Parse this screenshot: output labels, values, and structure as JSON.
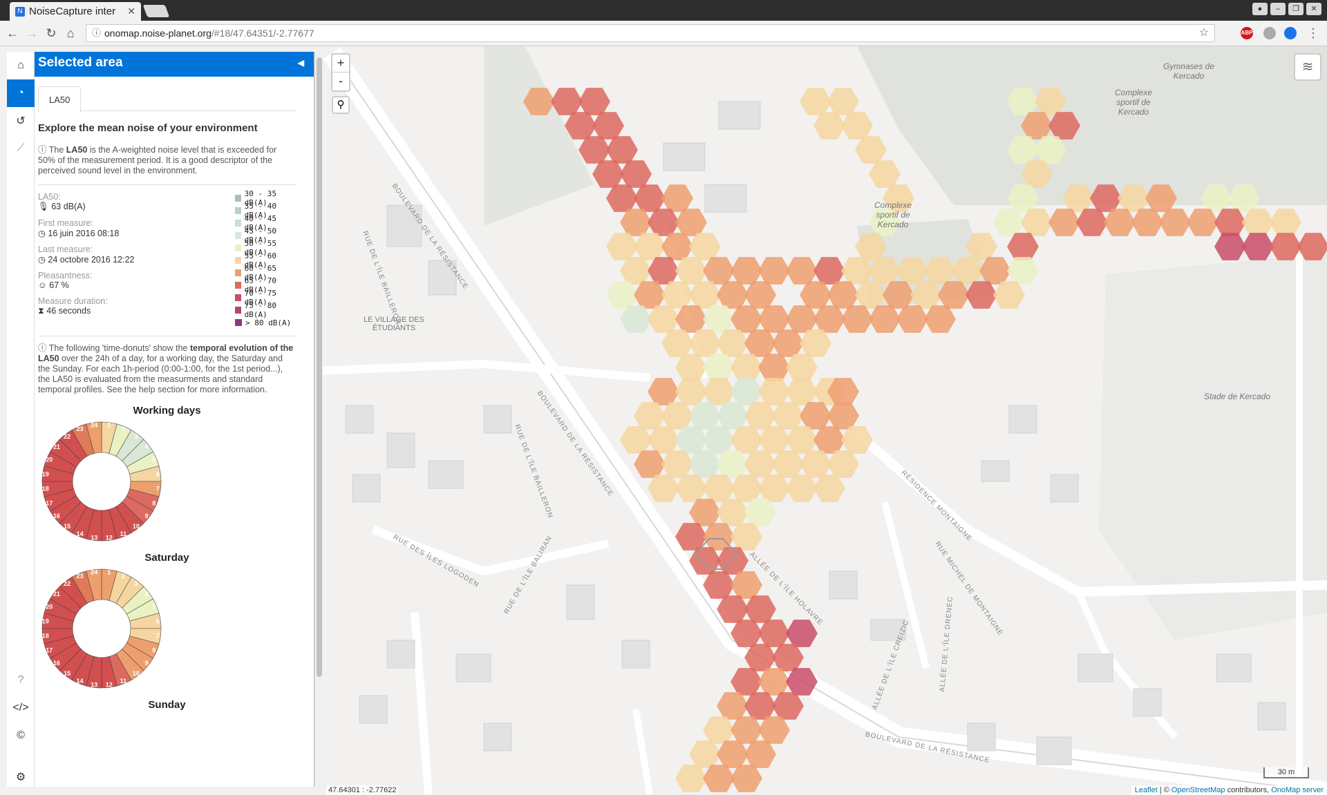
{
  "browser": {
    "tab_title": "NoiseCapture inter",
    "url_host": "onomap.noise-planet.org",
    "url_path": "/#18/47.64351/-2.77677",
    "ext_abp": "ABP"
  },
  "panel": {
    "title": "Selected area",
    "tab": "LA50",
    "heading": "Explore the mean noise of your environment",
    "intro_pre": " The ",
    "intro_bold": "LA50",
    "intro_post": " is the A-weighted noise level that is exceeded for 50% of the measurement period. It is a good descriptor of the perceived sound level in the environment.",
    "stats": {
      "la50_label": "LA50:",
      "la50_value": "63 dB(A)",
      "first_label": "First measure:",
      "first_value": "16 juin 2016 08:18",
      "last_label": "Last measure:",
      "last_value": "24 octobre 2016 12:22",
      "pleasant_label": "Pleasantness:",
      "pleasant_value": "67 %",
      "duration_label": "Measure duration:",
      "duration_value": "46 seconds"
    },
    "legend": [
      {
        "label": "30 - 35 dB(A)",
        "color": "#a9bcc4"
      },
      {
        "label": "35 - 40 dB(A)",
        "color": "#b8cdd4"
      },
      {
        "label": "40 - 45  dB(A)",
        "color": "#cadedb"
      },
      {
        "label": "45 - 50 dB(A)",
        "color": "#d9e8d4"
      },
      {
        "label": "50 - 55 dB(A)",
        "color": "#eaf2c4"
      },
      {
        "label": "55 - 60 dB(A)",
        "color": "#f6d6a0"
      },
      {
        "label": "60 - 65 dB(A)",
        "color": "#ee9f6e"
      },
      {
        "label": "65 - 70 dB(A)",
        "color": "#dd6a60"
      },
      {
        "label": "70 - 75 dB(A)",
        "color": "#c94d68"
      },
      {
        "label": "75 - 80 dB(A)",
        "color": "#b04679"
      },
      {
        "label": "> 80 dB(A)",
        "color": "#8a3a78"
      }
    ],
    "temporal_pre": " The following 'time-donuts' show the ",
    "temporal_bold1": "temporal evolution of the LA50",
    "temporal_post": " over the 24h of a day, for a working day, the Saturday and the Sunday. For each 1h-period (0:00-1:00, for the 1st period...), the LA50 is evaluated from the measurments and standard temporal profiles. See the help section for more information.",
    "donuts": [
      {
        "title": "Working days",
        "colors": [
          "#f6d6a0",
          "#eaf2c4",
          "#d9e8d4",
          "#d9e8d4",
          "#eaf2c4",
          "#f6d6a0",
          "#ee9f6e",
          "#dd6a60",
          "#dd6a60",
          "#d24f4f",
          "#d24f4f",
          "#d24f4f",
          "#d24f4f",
          "#d24f4f",
          "#d24f4f",
          "#d24f4f",
          "#d24f4f",
          "#d24f4f",
          "#d24f4f",
          "#d24f4f",
          "#d24f4f",
          "#d24f4f",
          "#e07b5a",
          "#ee9f6e"
        ]
      },
      {
        "title": "Saturday",
        "colors": [
          "#ee9f6e",
          "#f6d6a0",
          "#f6d6a0",
          "#eaf2c4",
          "#eaf2c4",
          "#f6d6a0",
          "#f6d6a0",
          "#ee9f6e",
          "#ee9f6e",
          "#ee9f6e",
          "#dd6a60",
          "#d24f4f",
          "#d24f4f",
          "#d24f4f",
          "#d24f4f",
          "#d24f4f",
          "#d24f4f",
          "#d24f4f",
          "#d24f4f",
          "#d24f4f",
          "#d24f4f",
          "#d24f4f",
          "#e07b5a",
          "#ee9f6e"
        ]
      },
      {
        "title": "Sunday",
        "colors": []
      }
    ]
  },
  "map": {
    "coords": "47.64301 : -2.77622",
    "scale": "30 m",
    "attrib_leaflet": "Leaflet",
    "attrib_mid": " | © ",
    "attrib_osm": "OpenStreetMap",
    "attrib_contrib": " contributors, ",
    "attrib_onomap": "OnoMap server",
    "zoom_in": "+",
    "zoom_out": "-",
    "labels": {
      "gymnases": "Gymnases de Kercado",
      "complexe_right": "Complexe sportif de Kercado",
      "complexe_left": "Complexe sportif de Kercado",
      "village": "LE VILLAGE DES ÉTUDIANTS",
      "stade": "Stade de Kercado",
      "bd_resistance_1": "BOULEVARD DE LA RÉSISTANCE",
      "bd_resistance_2": "BOULEVARD DE LA RÉSISTANCE",
      "bd_resistance_3": "BOULEVARD DE LA RÉSISTANCE",
      "rue_baileron_1": "RUE DE L'ÎLE BAILLERON",
      "rue_baileron_2": "RUE DE L'ÎLE BAILLERON",
      "rue_logoden": "RUE DES ÎLES LOGODEN",
      "rue_baliran": "RUE DE L'ÎLE BALIRAN",
      "rue_montaigne": "RUE MICHEL DE MONTAIGNE",
      "residence": "RÉSIDENCE MONTAIGNE",
      "allee_holavre": "ALLÉE DE L'ÎLE HOLAVRE",
      "allee_creizic": "ALLÉE DE L'ÎLE CREIZIC",
      "allee_drenec": "ALLÉE DE L'ÎLE DRENEC"
    }
  },
  "hexgrid": [
    [
      780,
      80,
      "#ee9f6e"
    ],
    [
      820,
      80,
      "#dd6a60"
    ],
    [
      860,
      80,
      "#dd6a60"
    ],
    [
      1180,
      80,
      "#f6d6a0"
    ],
    [
      1220,
      80,
      "#f6d6a0"
    ],
    [
      1480,
      80,
      "#eaf2c4"
    ],
    [
      1520,
      80,
      "#f6d6a0"
    ],
    [
      840,
      115,
      "#dd6a60"
    ],
    [
      880,
      115,
      "#dd6a60"
    ],
    [
      1200,
      115,
      "#f6d6a0"
    ],
    [
      1240,
      115,
      "#f6d6a0"
    ],
    [
      1500,
      115,
      "#ee9f6e"
    ],
    [
      1540,
      115,
      "#dd6a60"
    ],
    [
      860,
      150,
      "#dd6a60"
    ],
    [
      900,
      150,
      "#dd6a60"
    ],
    [
      1260,
      150,
      "#f6d6a0"
    ],
    [
      1480,
      150,
      "#eaf2c4"
    ],
    [
      1520,
      150,
      "#eaf2c4"
    ],
    [
      880,
      185,
      "#dd6a60"
    ],
    [
      920,
      185,
      "#dd6a60"
    ],
    [
      1280,
      185,
      "#f6d6a0"
    ],
    [
      1500,
      185,
      "#f6d6a0"
    ],
    [
      900,
      220,
      "#dd6a60"
    ],
    [
      940,
      220,
      "#dd6a60"
    ],
    [
      980,
      220,
      "#ee9f6e"
    ],
    [
      1300,
      220,
      "#f6d6a0"
    ],
    [
      1480,
      220,
      "#eaf2c4"
    ],
    [
      1560,
      220,
      "#f6d6a0"
    ],
    [
      1600,
      220,
      "#dd6a60"
    ],
    [
      1640,
      220,
      "#f6d6a0"
    ],
    [
      1680,
      220,
      "#ee9f6e"
    ],
    [
      1760,
      220,
      "#eaf2c4"
    ],
    [
      1800,
      220,
      "#eaf2c4"
    ],
    [
      920,
      255,
      "#ee9f6e"
    ],
    [
      960,
      255,
      "#dd6a60"
    ],
    [
      1000,
      255,
      "#ee9f6e"
    ],
    [
      1280,
      255,
      "#eaf2c4"
    ],
    [
      1460,
      255,
      "#eaf2c4"
    ],
    [
      1500,
      255,
      "#f6d6a0"
    ],
    [
      1540,
      255,
      "#ee9f6e"
    ],
    [
      1580,
      255,
      "#dd6a60"
    ],
    [
      1620,
      255,
      "#ee9f6e"
    ],
    [
      1660,
      255,
      "#ee9f6e"
    ],
    [
      1700,
      255,
      "#ee9f6e"
    ],
    [
      1740,
      255,
      "#ee9f6e"
    ],
    [
      1780,
      255,
      "#dd6a60"
    ],
    [
      1820,
      255,
      "#f6d6a0"
    ],
    [
      1860,
      255,
      "#f6d6a0"
    ],
    [
      900,
      290,
      "#f6d6a0"
    ],
    [
      940,
      290,
      "#f6d6a0"
    ],
    [
      980,
      290,
      "#ee9f6e"
    ],
    [
      1020,
      290,
      "#f6d6a0"
    ],
    [
      1260,
      290,
      "#f6d6a0"
    ],
    [
      1420,
      290,
      "#f6d6a0"
    ],
    [
      1480,
      290,
      "#dd6a60"
    ],
    [
      1780,
      290,
      "#c94d68"
    ],
    [
      1820,
      290,
      "#c94d68"
    ],
    [
      1860,
      290,
      "#dd6a60"
    ],
    [
      1900,
      290,
      "#dd6a60"
    ],
    [
      920,
      325,
      "#f6d6a0"
    ],
    [
      960,
      325,
      "#dd6a60"
    ],
    [
      1000,
      325,
      "#f6d6a0"
    ],
    [
      1040,
      325,
      "#ee9f6e"
    ],
    [
      1080,
      325,
      "#ee9f6e"
    ],
    [
      1120,
      325,
      "#ee9f6e"
    ],
    [
      1160,
      325,
      "#ee9f6e"
    ],
    [
      1200,
      325,
      "#dd6a60"
    ],
    [
      1240,
      325,
      "#f6d6a0"
    ],
    [
      1280,
      325,
      "#f6d6a0"
    ],
    [
      1320,
      325,
      "#f6d6a0"
    ],
    [
      1360,
      325,
      "#f6d6a0"
    ],
    [
      1400,
      325,
      "#f6d6a0"
    ],
    [
      1440,
      325,
      "#ee9f6e"
    ],
    [
      1480,
      325,
      "#eaf2c4"
    ],
    [
      900,
      360,
      "#eaf2c4"
    ],
    [
      940,
      360,
      "#ee9f6e"
    ],
    [
      980,
      360,
      "#f6d6a0"
    ],
    [
      1020,
      360,
      "#f6d6a0"
    ],
    [
      1060,
      360,
      "#ee9f6e"
    ],
    [
      1100,
      360,
      "#ee9f6e"
    ],
    [
      1180,
      360,
      "#ee9f6e"
    ],
    [
      1220,
      360,
      "#ee9f6e"
    ],
    [
      1260,
      360,
      "#f6d6a0"
    ],
    [
      1300,
      360,
      "#ee9f6e"
    ],
    [
      1340,
      360,
      "#f6d6a0"
    ],
    [
      1380,
      360,
      "#ee9f6e"
    ],
    [
      1420,
      360,
      "#dd6a60"
    ],
    [
      1460,
      360,
      "#f6d6a0"
    ],
    [
      920,
      395,
      "#d9e8d4"
    ],
    [
      960,
      395,
      "#f6d6a0"
    ],
    [
      1000,
      395,
      "#ee9f6e"
    ],
    [
      1040,
      395,
      "#eaf2c4"
    ],
    [
      1080,
      395,
      "#ee9f6e"
    ],
    [
      1120,
      395,
      "#ee9f6e"
    ],
    [
      1160,
      395,
      "#ee9f6e"
    ],
    [
      1200,
      395,
      "#ee9f6e"
    ],
    [
      1240,
      395,
      "#ee9f6e"
    ],
    [
      1280,
      395,
      "#ee9f6e"
    ],
    [
      1320,
      395,
      "#ee9f6e"
    ],
    [
      1360,
      395,
      "#ee9f6e"
    ],
    [
      980,
      430,
      "#f6d6a0"
    ],
    [
      1020,
      430,
      "#f6d6a0"
    ],
    [
      1060,
      430,
      "#f6d6a0"
    ],
    [
      1100,
      430,
      "#ee9f6e"
    ],
    [
      1140,
      430,
      "#ee9f6e"
    ],
    [
      1180,
      430,
      "#f6d6a0"
    ],
    [
      1000,
      465,
      "#f6d6a0"
    ],
    [
      1040,
      465,
      "#eaf2c4"
    ],
    [
      1080,
      465,
      "#f6d6a0"
    ],
    [
      1120,
      465,
      "#ee9f6e"
    ],
    [
      1160,
      465,
      "#f6d6a0"
    ],
    [
      960,
      500,
      "#ee9f6e"
    ],
    [
      1000,
      500,
      "#f6d6a0"
    ],
    [
      1040,
      500,
      "#f6d6a0"
    ],
    [
      1080,
      500,
      "#d9e8d4"
    ],
    [
      1120,
      500,
      "#f6d6a0"
    ],
    [
      1160,
      500,
      "#f6d6a0"
    ],
    [
      1200,
      500,
      "#f6d6a0"
    ],
    [
      1220,
      500,
      "#ee9f6e"
    ],
    [
      940,
      535,
      "#f6d6a0"
    ],
    [
      980,
      535,
      "#f6d6a0"
    ],
    [
      1020,
      535,
      "#d9e8d4"
    ],
    [
      1060,
      535,
      "#d9e8d4"
    ],
    [
      1100,
      535,
      "#f6d6a0"
    ],
    [
      1140,
      535,
      "#f6d6a0"
    ],
    [
      1180,
      535,
      "#ee9f6e"
    ],
    [
      1220,
      535,
      "#ee9f6e"
    ],
    [
      920,
      570,
      "#f6d6a0"
    ],
    [
      960,
      570,
      "#f6d6a0"
    ],
    [
      1000,
      570,
      "#d9e8d4"
    ],
    [
      1040,
      570,
      "#d9e8d4"
    ],
    [
      1080,
      570,
      "#f6d6a0"
    ],
    [
      1120,
      570,
      "#f6d6a0"
    ],
    [
      1160,
      570,
      "#f6d6a0"
    ],
    [
      1200,
      570,
      "#ee9f6e"
    ],
    [
      1240,
      570,
      "#f6d6a0"
    ],
    [
      940,
      605,
      "#ee9f6e"
    ],
    [
      980,
      605,
      "#f6d6a0"
    ],
    [
      1020,
      605,
      "#d9e8d4"
    ],
    [
      1060,
      605,
      "#eaf2c4"
    ],
    [
      1100,
      605,
      "#f6d6a0"
    ],
    [
      1140,
      605,
      "#f6d6a0"
    ],
    [
      1180,
      605,
      "#f6d6a0"
    ],
    [
      1220,
      605,
      "#f6d6a0"
    ],
    [
      960,
      640,
      "#f6d6a0"
    ],
    [
      1000,
      640,
      "#f6d6a0"
    ],
    [
      1040,
      640,
      "#f6d6a0"
    ],
    [
      1080,
      640,
      "#f6d6a0"
    ],
    [
      1120,
      640,
      "#f6d6a0"
    ],
    [
      1160,
      640,
      "#f6d6a0"
    ],
    [
      1200,
      640,
      "#f6d6a0"
    ],
    [
      1020,
      675,
      "#ee9f6e"
    ],
    [
      1060,
      675,
      "#f6d6a0"
    ],
    [
      1100,
      675,
      "#eaf2c4"
    ],
    [
      1000,
      710,
      "#dd6a60"
    ],
    [
      1040,
      710,
      "#ee9f6e"
    ],
    [
      1080,
      710,
      "#f6d6a0"
    ],
    [
      1020,
      745,
      "#dd6a60"
    ],
    [
      1060,
      745,
      "#dd6a60"
    ],
    [
      1040,
      780,
      "#dd6a60"
    ],
    [
      1080,
      780,
      "#ee9f6e"
    ],
    [
      1060,
      815,
      "#dd6a60"
    ],
    [
      1100,
      815,
      "#dd6a60"
    ],
    [
      1080,
      850,
      "#dd6a60"
    ],
    [
      1120,
      850,
      "#dd6a60"
    ],
    [
      1160,
      850,
      "#c94d68"
    ],
    [
      1100,
      885,
      "#dd6a60"
    ],
    [
      1140,
      885,
      "#dd6a60"
    ],
    [
      1080,
      920,
      "#dd6a60"
    ],
    [
      1120,
      920,
      "#ee9f6e"
    ],
    [
      1160,
      920,
      "#c94d68"
    ],
    [
      1060,
      955,
      "#ee9f6e"
    ],
    [
      1100,
      955,
      "#dd6a60"
    ],
    [
      1140,
      955,
      "#dd6a60"
    ],
    [
      1040,
      990,
      "#f6d6a0"
    ],
    [
      1080,
      990,
      "#ee9f6e"
    ],
    [
      1120,
      990,
      "#ee9f6e"
    ],
    [
      1020,
      1025,
      "#f6d6a0"
    ],
    [
      1060,
      1025,
      "#ee9f6e"
    ],
    [
      1100,
      1025,
      "#ee9f6e"
    ],
    [
      1000,
      1060,
      "#f6d6a0"
    ],
    [
      1040,
      1060,
      "#ee9f6e"
    ],
    [
      1080,
      1060,
      "#ee9f6e"
    ]
  ]
}
